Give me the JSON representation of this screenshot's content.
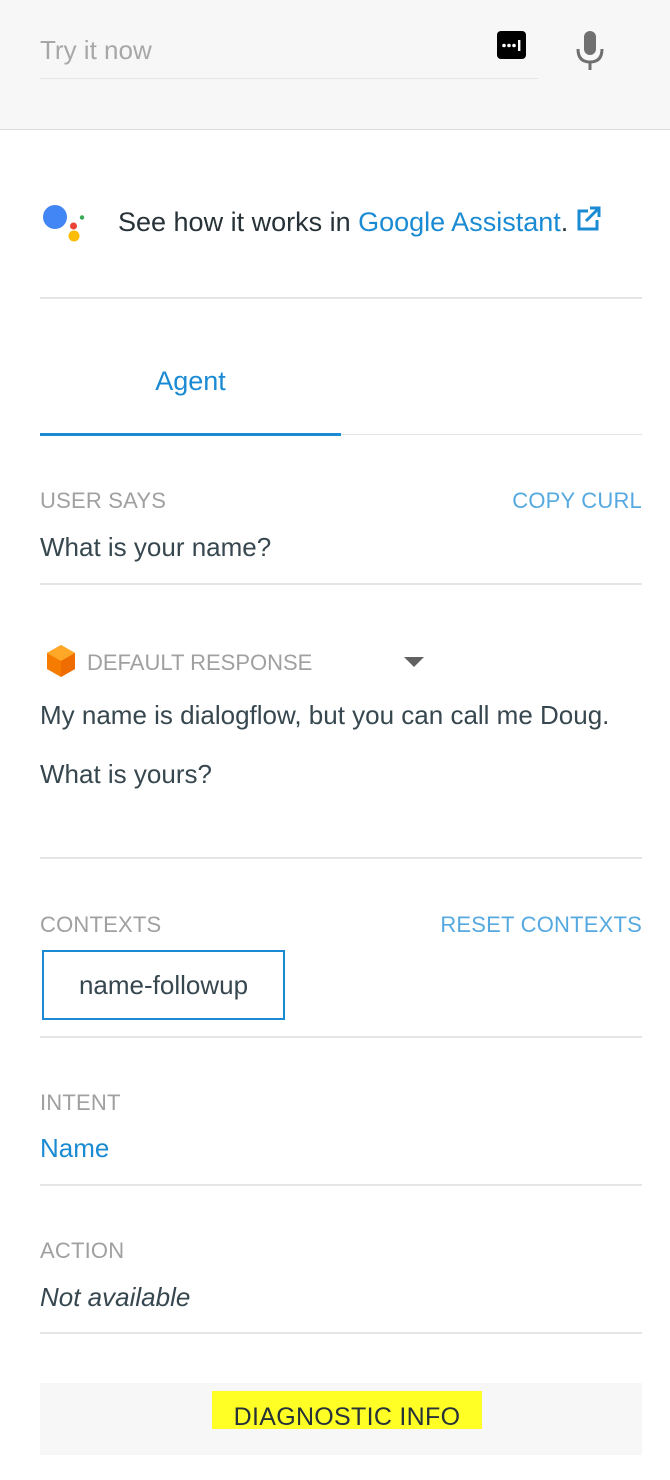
{
  "topbar": {
    "input_placeholder": "Try it now",
    "icons": {
      "keyboard": "keyboard-icon",
      "mic": "microphone-icon"
    }
  },
  "assistant_promo": {
    "text": "See how it works in ",
    "link": "Google Assistant",
    "suffix": ".",
    "icons": {
      "logo": "google-assistant-icon",
      "external": "external-link-icon"
    }
  },
  "tabs": [
    {
      "label": "Agent",
      "active": true
    }
  ],
  "user_says": {
    "label": "USER SAYS",
    "action": "COPY CURL",
    "value": "What is your name?"
  },
  "default_response": {
    "label": "DEFAULT RESPONSE",
    "lines": [
      "My name is dialogflow, but you can call me Doug.",
      "What is yours?"
    ],
    "icons": {
      "response": "response-cube-icon",
      "dropdown": "caret-down-icon"
    }
  },
  "contexts": {
    "label": "CONTEXTS",
    "action": "RESET CONTEXTS",
    "items": [
      "name-followup"
    ]
  },
  "intent": {
    "label": "INTENT",
    "value": "Name"
  },
  "action": {
    "label": "ACTION",
    "value": "Not available"
  },
  "diagnostic": {
    "label": "DIAGNOSTIC INFO",
    "highlight_color": "#ffff26"
  },
  "colors": {
    "accent": "#1a8bd3",
    "label_gray": "#a0a0a0",
    "topbar_bg": "#f7f7f7"
  }
}
